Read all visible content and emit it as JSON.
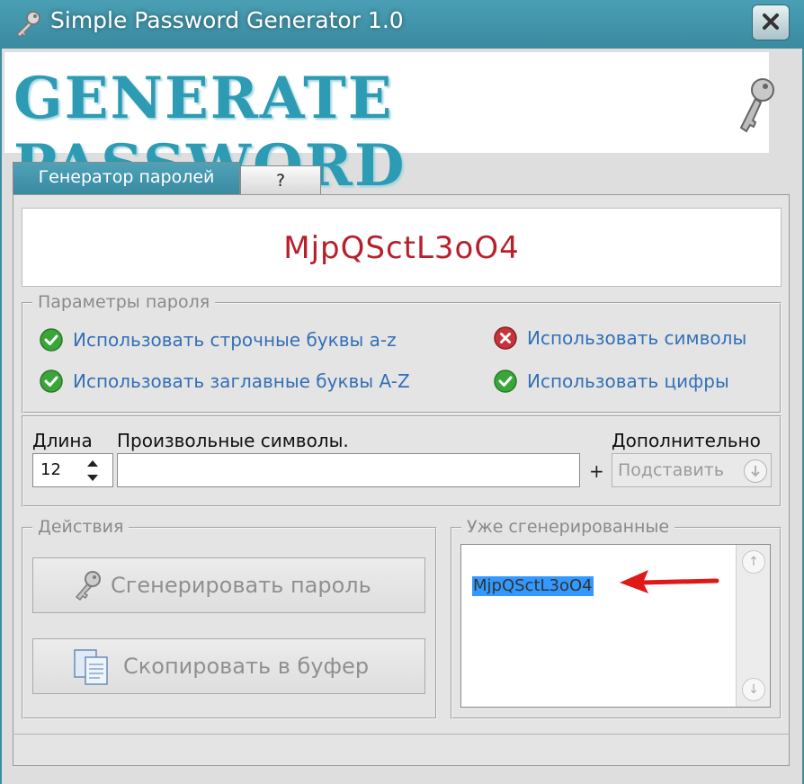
{
  "window": {
    "title": "Simple Password Generator 1.0",
    "close_icon": "close-icon"
  },
  "banner": {
    "text": "GENERATE PASSWORD",
    "icon": "key-icon"
  },
  "tabs": [
    {
      "label": "Генератор паролей",
      "active": true
    },
    {
      "label": "?",
      "active": false
    }
  ],
  "password": {
    "value": "MjpQSctL3oO4",
    "color": "#b81f2c"
  },
  "params": {
    "legend": "Параметры пароля",
    "options": [
      {
        "label": "Использовать строчные буквы a-z",
        "checked": true
      },
      {
        "label": "Использовать символы",
        "checked": false
      },
      {
        "label": "Использовать заглавные буквы A-Z",
        "checked": true
      },
      {
        "label": "Использовать цифры",
        "checked": true
      }
    ]
  },
  "length": {
    "label": "Длина",
    "value": "12"
  },
  "custom": {
    "label": "Произвольные символы.",
    "value": "",
    "plus": "+"
  },
  "extra": {
    "label": "Дополнительно",
    "button": "Подставить"
  },
  "actions": {
    "legend": "Действия",
    "generate": "Сгенерировать пароль",
    "copy": "Скопировать в буфер"
  },
  "history": {
    "legend": "Уже сгенерированные",
    "items": [
      "MjpQSctL3oO4"
    ]
  },
  "colors": {
    "accent": "#3f8fa3",
    "link": "#3370b7",
    "check_ok": "#3aa63a",
    "check_no": "#c8323a"
  }
}
